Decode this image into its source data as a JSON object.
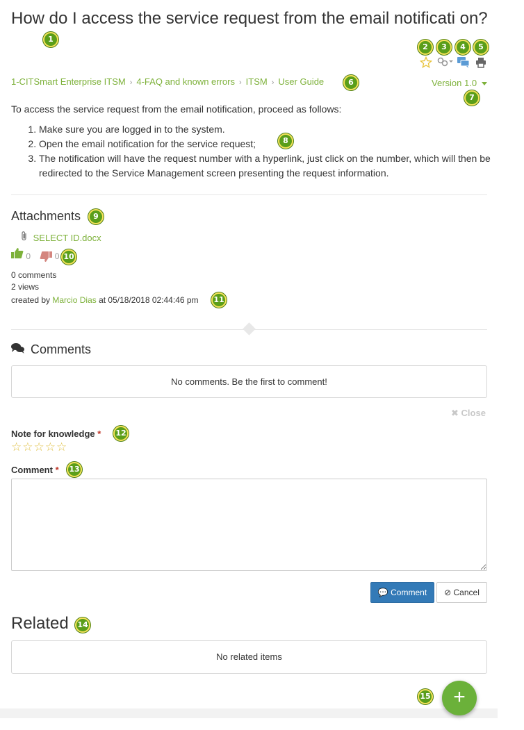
{
  "article": {
    "title": "How do I access the service request from the email notificati on?",
    "intro": "To access the service request from the email notification, proceed as follows:",
    "steps": [
      "Make sure you are logged in to the system.",
      "Open the email notification for the service request;",
      "The notification will have the request number with a hyperlink, just click on the number, which will then be redirected to the Service Management screen presenting the request information."
    ]
  },
  "breadcrumb": {
    "items": [
      "1-CITSmart Enterprise ITSM",
      "4-FAQ and known errors",
      "ITSM",
      "User Guide"
    ],
    "separator": "›"
  },
  "version": {
    "label": "Version 1.0"
  },
  "attachments": {
    "heading": "Attachments",
    "files": [
      "SELECT ID.docx"
    ]
  },
  "votes": {
    "up": "0",
    "down": "0"
  },
  "stats": {
    "comments": "0 comments",
    "views": "2 views",
    "created_prefix": "created by",
    "author": "Marcio Dias",
    "created_suffix": "at 05/18/2018 02:44:46 pm"
  },
  "comments": {
    "heading": "Comments",
    "empty": "No comments. Be the first to comment!",
    "close": "Close",
    "note_label": "Note for knowledge",
    "comment_label": "Comment",
    "required_mark": "*",
    "comment_value": "",
    "submit": "Comment",
    "cancel": "Cancel"
  },
  "related": {
    "heading": "Related",
    "empty": "No related items"
  },
  "badges": [
    "1",
    "2",
    "3",
    "4",
    "5",
    "6",
    "7",
    "8",
    "9",
    "10",
    "11",
    "12",
    "13",
    "14",
    "15"
  ],
  "colors": {
    "accent": "#7db13a",
    "primary_button": "#337ab7",
    "badge": "#5a9e1a",
    "star": "#e0c24a",
    "fab": "#6bb13a"
  },
  "icons": {
    "favorite": "star-outline-icon",
    "link": "link-icon",
    "comment": "chat-icon",
    "print": "print-icon",
    "attachment": "paperclip-icon",
    "like": "thumbs-up-icon",
    "dislike": "thumbs-down-icon",
    "comments": "comments-icon",
    "close": "close-icon",
    "add": "plus-icon"
  }
}
